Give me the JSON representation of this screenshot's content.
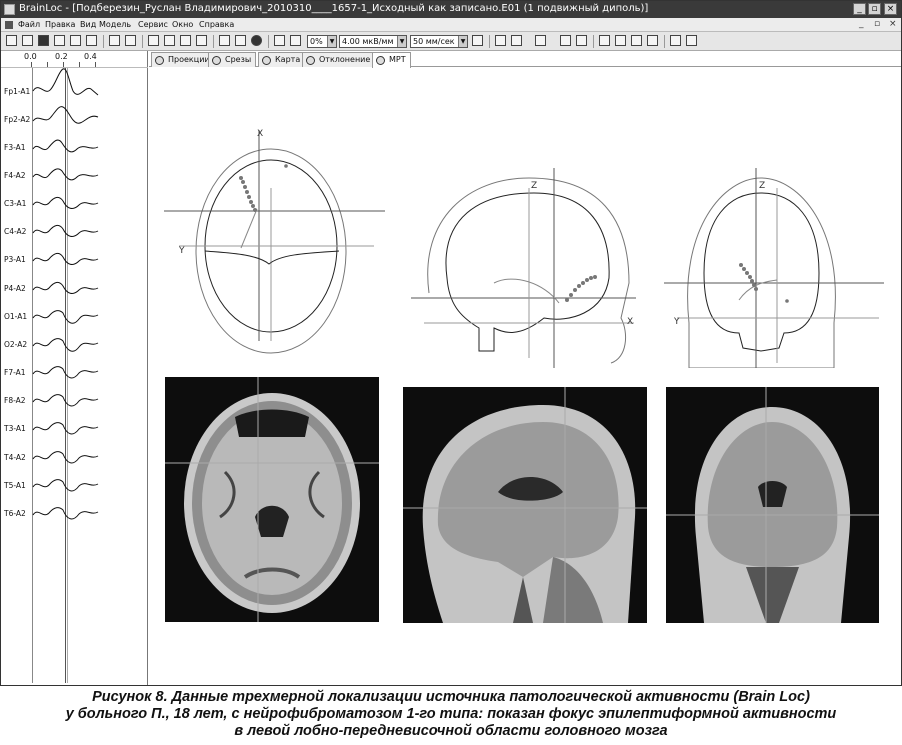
{
  "window": {
    "title": "BrainLoc - [Подберезин_Руслан Владимирович_2010310____1657-1_Исходный как записано.E01 (1 подвижный диполь)]",
    "controls": [
      "_",
      "▫",
      "×"
    ]
  },
  "menu": {
    "items": [
      "Файл",
      "Правка",
      "Вид",
      "Модель",
      "Сервис",
      "Окно",
      "Справка"
    ],
    "mdi_controls": [
      "_",
      "▫",
      "×"
    ]
  },
  "toolbar": {
    "percent_value": "0%",
    "sensitivity_value": "4.00 мкВ/мм",
    "speed_value": "50 мм/сек"
  },
  "eeg": {
    "scale_labels": [
      "0.0",
      "0.2",
      "0.4"
    ],
    "channels": [
      "Fp1-A1",
      "Fp2-A2",
      "F3-A1",
      "F4-A2",
      "C3-A1",
      "C4-A2",
      "P3-A1",
      "P4-A2",
      "O1-A1",
      "O2-A2",
      "F7-A1",
      "F8-A2",
      "T3-A1",
      "T4-A2",
      "T5-A1",
      "T6-A2"
    ]
  },
  "tabs": [
    {
      "label": "Проекции",
      "icon": "projections-icon",
      "active": false
    },
    {
      "label": "Срезы",
      "icon": "slices-icon",
      "active": false
    },
    {
      "label": "Карта",
      "icon": "map-icon",
      "active": false
    },
    {
      "label": "Отклонение",
      "icon": "deviation-icon",
      "active": false
    },
    {
      "label": "МРТ",
      "icon": "mri-icon",
      "active": true
    }
  ],
  "axes": {
    "axial": {
      "x": "X",
      "y": "Y"
    },
    "sagittal": {
      "x": "X",
      "z": "Z"
    },
    "coronal": {
      "y": "Y",
      "z": "Z"
    }
  },
  "caption": {
    "line1": "Рисунок 8. Данные трехмерной локализации источника патологической активности (Brain Loc)",
    "line2": "у больного П., 18 лет, с нейрофиброматозом 1-го типа: показан фокус эпилептиформной активности",
    "line3": "в левой лобно-передневисочной области головного мозга"
  }
}
